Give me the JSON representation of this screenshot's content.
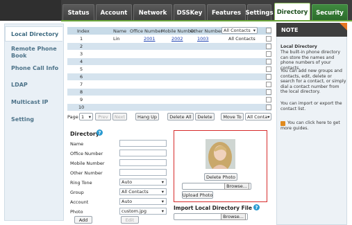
{
  "tabs": [
    {
      "label": "Status"
    },
    {
      "label": "Account"
    },
    {
      "label": "Network"
    },
    {
      "label": "DSSKey"
    },
    {
      "label": "Features"
    },
    {
      "label": "Settings"
    },
    {
      "label": "Directory"
    },
    {
      "label": "Security"
    }
  ],
  "sidebar": {
    "items": [
      {
        "label": "Local Directory"
      },
      {
        "label": "Remote Phone Book"
      },
      {
        "label": "Phone Call Info"
      },
      {
        "label": "LDAP"
      },
      {
        "label": "Multicast IP"
      },
      {
        "label": "Setting"
      }
    ]
  },
  "table": {
    "headers": [
      "Index",
      "Name",
      "Office Number",
      "Mobile Number",
      "Other Number"
    ],
    "filter": "All Contacts",
    "rows": [
      {
        "index": "1",
        "name": "Lin",
        "office": "2001",
        "mobile": "2002",
        "other": "1003",
        "group": "All Contacts"
      },
      {
        "index": "2",
        "name": "",
        "office": "",
        "mobile": "",
        "other": "",
        "group": ""
      },
      {
        "index": "3",
        "name": "",
        "office": "",
        "mobile": "",
        "other": "",
        "group": ""
      },
      {
        "index": "4",
        "name": "",
        "office": "",
        "mobile": "",
        "other": "",
        "group": ""
      },
      {
        "index": "5",
        "name": "",
        "office": "",
        "mobile": "",
        "other": "",
        "group": ""
      },
      {
        "index": "6",
        "name": "",
        "office": "",
        "mobile": "",
        "other": "",
        "group": ""
      },
      {
        "index": "7",
        "name": "",
        "office": "",
        "mobile": "",
        "other": "",
        "group": ""
      },
      {
        "index": "8",
        "name": "",
        "office": "",
        "mobile": "",
        "other": "",
        "group": ""
      },
      {
        "index": "9",
        "name": "",
        "office": "",
        "mobile": "",
        "other": "",
        "group": ""
      },
      {
        "index": "10",
        "name": "",
        "office": "",
        "mobile": "",
        "other": "",
        "group": ""
      }
    ]
  },
  "pager": {
    "page_label": "Page",
    "page_value": "1",
    "prev": "Prev",
    "next": "Next",
    "hang_up": "Hang Up",
    "delete_all": "Delete All",
    "delete": "Delete",
    "move_to": "Move To",
    "move_target": "All Conta"
  },
  "directory": {
    "title": "Directory",
    "fields": {
      "name": "Name",
      "office": "Office Number",
      "mobile": "Mobile Number",
      "other": "Other Number",
      "ring": "Ring Tone",
      "group": "Group",
      "account": "Account",
      "photo": "Photo"
    },
    "ring_value": "Auto",
    "group_value": "All Contacts",
    "account_value": "Auto",
    "photo_value": "custom.jpg",
    "add": "Add",
    "edit": "Edit"
  },
  "photo": {
    "delete": "Delete Photo",
    "browse": "Browse...",
    "upload": "Upload Photo"
  },
  "import": {
    "title": "Import Local Directory File",
    "browse": "Browse..."
  },
  "note": {
    "title": "NOTE",
    "heading": "Local Directory",
    "p1": "The built-in phone directory can store the names and phone numbers of your contacts.",
    "p2": "You can add new groups and contacts, edit, delete or search for a contact, or simply dial a contact number from the local directory.",
    "p3": "You can import or export the contact list.",
    "p4": "You can click here to get more guides."
  },
  "colors": {
    "accent_green": "#6aa63a",
    "topbar": "#3d3d3d",
    "row_alt": "#d5e3ee",
    "highlight_box": "#d62a2a",
    "nav_text": "#4d7389"
  }
}
